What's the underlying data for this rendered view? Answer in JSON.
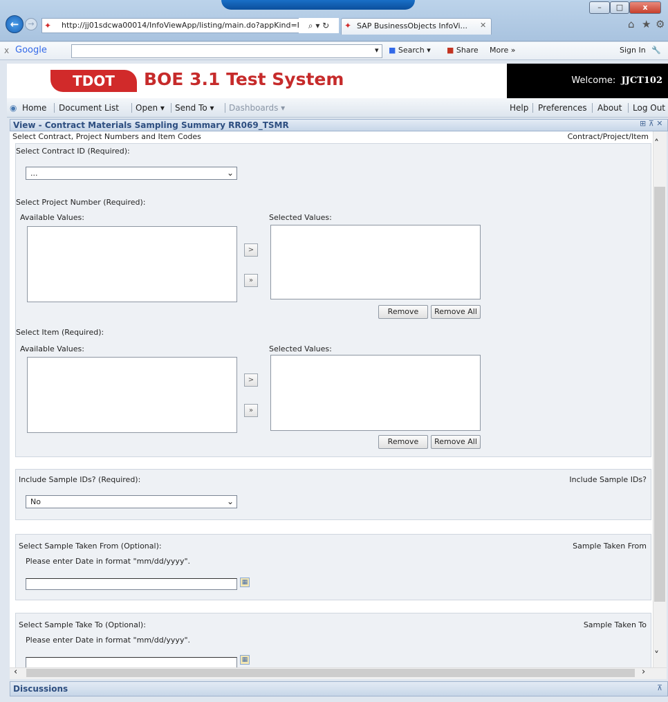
{
  "browser": {
    "url": "http://jj01sdcwa00014/InfoViewApp/listing/main.do?appKind=I",
    "tab_title": "SAP BusinessObjects InfoVi...",
    "window_buttons": {
      "minimize": "–",
      "maximize": "□",
      "close": "x"
    },
    "icons": {
      "home": "⌂",
      "favorites": "★",
      "tools": "⚙"
    }
  },
  "google_bar": {
    "close": "x",
    "logo": "Google",
    "search_label": "Search",
    "share_label": "Share",
    "more_label": "More »",
    "signin_label": "Sign In"
  },
  "app": {
    "logo_text": "TDOT",
    "title": "BOE 3.1 Test System",
    "welcome_label": "Welcome:",
    "username": "JJCT102"
  },
  "menu": {
    "home": "Home",
    "document_list": "Document List",
    "open": "Open ▾",
    "send_to": "Send To ▾",
    "dashboards": "Dashboards ▾",
    "help": "Help",
    "preferences": "Preferences",
    "about": "About",
    "logout": "Log Out"
  },
  "view": {
    "title": "View - Contract Materials Sampling Summary RR069_TSMR",
    "subtitle": "Select Contract, Project Numbers and Item Codes",
    "subtitle_right": "Contract/Project/Item",
    "contract_label": "Select Contract ID (Required):",
    "contract_value": "...",
    "project_label": "Select Project Number (Required):",
    "available_label": "Available Values:",
    "selected_label": "Selected Values:",
    "add_symbol": ">",
    "add_all_symbol": "»",
    "remove_label": "Remove",
    "remove_all_label": "Remove All",
    "item_label": "Select Item (Required):",
    "include_label": "Include Sample IDs? (Required):",
    "include_right": "Include Sample IDs?",
    "include_value": "No",
    "from_label": "Select Sample Taken From (Optional):",
    "from_right": "Sample Taken From",
    "date_hint": "Please enter Date in format \"mm/dd/yyyy\".",
    "to_label": "Select Sample Take To (Optional):",
    "to_right": "Sample Taken To"
  },
  "discussions": {
    "title": "Discussions"
  }
}
